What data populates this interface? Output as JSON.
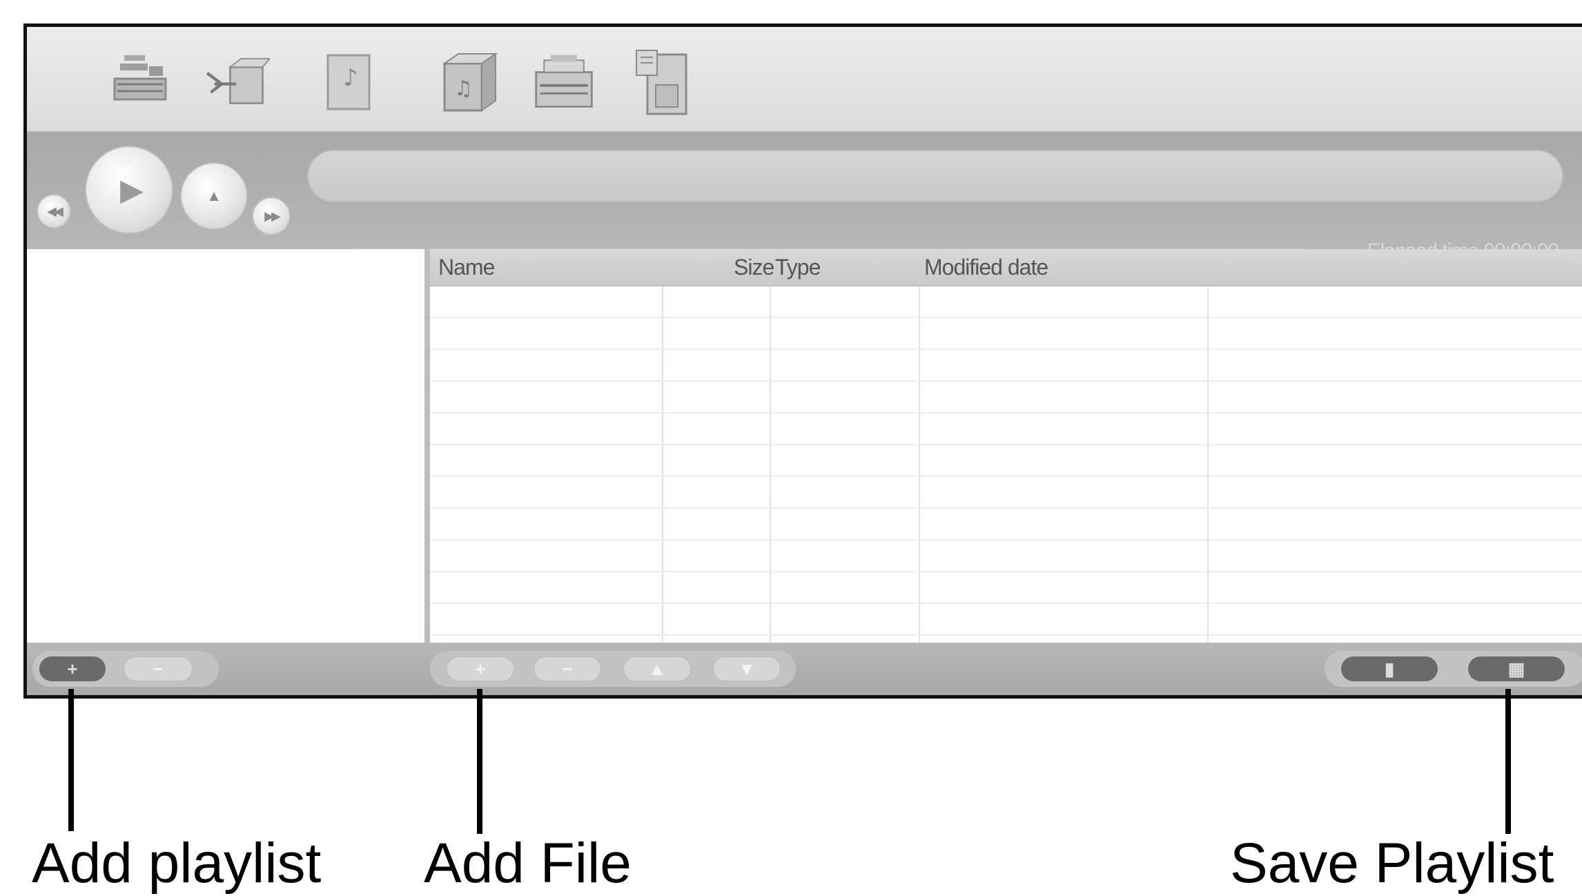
{
  "toolbar": {
    "icons": [
      "settings-icon",
      "transfer-icon",
      "music-file-icon",
      "music-library-icon",
      "playlist-box-icon",
      "device-file-icon"
    ]
  },
  "player": {
    "elapsed_label": "Elapsed time 00:00:00"
  },
  "file_list": {
    "columns": [
      "Name",
      "Size",
      "Type",
      "Modified date"
    ],
    "rows": []
  },
  "bottom_bar": {
    "playlist_buttons": [
      "+",
      "−"
    ],
    "file_buttons": [
      "+",
      "−",
      "▲",
      "▼"
    ],
    "right_buttons": [
      "▮",
      "▦"
    ]
  },
  "callouts": {
    "add_playlist": "Add playlist",
    "add_file": "Add File",
    "save_playlist": "Save Playlist"
  }
}
